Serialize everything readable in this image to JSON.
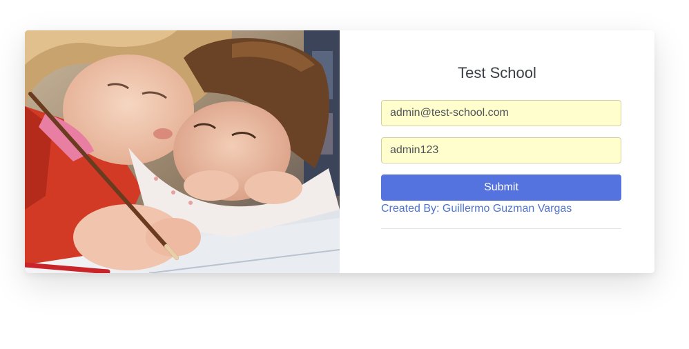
{
  "school": {
    "title": "Test School"
  },
  "login": {
    "email_value": "admin@test-school.com",
    "password_value": "admin123",
    "submit_label": "Submit"
  },
  "footer": {
    "credit": "Created By: Guillermo Guzman Vargas"
  },
  "colors": {
    "accent": "#5573df",
    "link": "#4f74d0",
    "autofill_bg": "#fffecc"
  },
  "image": {
    "subject": "children drawing with pencil"
  }
}
